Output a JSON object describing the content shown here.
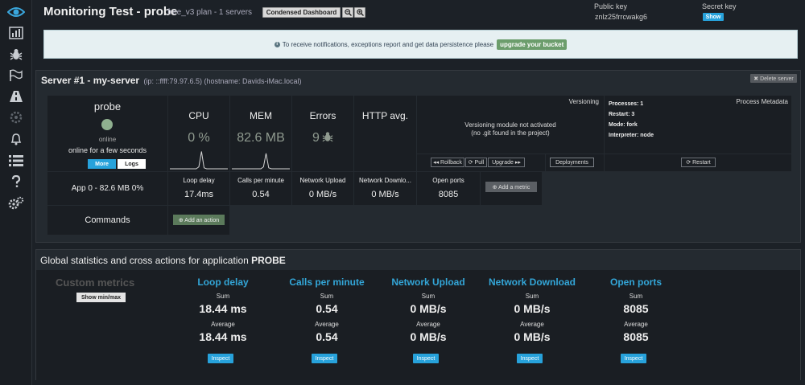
{
  "header": {
    "title": "Monitoring Test - probe",
    "plan_info": "free_v3 plan - 1 servers",
    "condensed_label": "Condensed Dashboard",
    "public_key_label": "Public key",
    "public_key_value": "znlz25frrcwakg6",
    "secret_key_label": "Secret key",
    "show_label": "Show"
  },
  "sidebar": {
    "icons": [
      "eye-icon",
      "bar-chart-icon",
      "bug-icon",
      "flag-icon",
      "road-icon",
      "cogs-icon",
      "bell-icon",
      "list-icon",
      "question-icon",
      "gears-icon"
    ]
  },
  "notice": {
    "text": "To receive notifications, exceptions report and get data persistence please",
    "button": "upgrade your bucket"
  },
  "server": {
    "title": "Server #1 - my-server",
    "subtitle": "(ip: ::ffff:79.97.6.5) (hostname: Davids-iMac.local)",
    "delete_label": "✖ Delete server",
    "process": {
      "name": "probe",
      "status": "online",
      "duration": "online for a few seconds",
      "more": "More",
      "logs": "Logs"
    },
    "metrics": {
      "cpu_label": "CPU",
      "cpu_value": "0 %",
      "mem_label": "MEM",
      "mem_value": "82.6 MB",
      "errors_label": "Errors",
      "errors_value": "9",
      "http_label": "HTTP avg."
    },
    "versioning": {
      "label": "Versioning",
      "message_line1": "Versioning module not activated",
      "message_line2": "(no .git found in the project)",
      "rollback": "◂◂ Rollback",
      "pull": "⟳ Pull",
      "upgrade": "Upgrade ▸▸",
      "deployments": "Deployments"
    },
    "process_meta": {
      "label": "Process Metadata",
      "processes": "Processes: 1",
      "restart_count": "Restart: 3",
      "mode": "Mode: fork",
      "interpreter": "Interpreter: node",
      "restart_button": "⟳ Restart"
    },
    "app_row": {
      "label": "App 0 - 82.6 MB 0%",
      "loop_label": "Loop delay",
      "loop_value": "17.4ms",
      "calls_label": "Calls per minute",
      "calls_value": "0.54",
      "up_label": "Network Upload",
      "up_value": "0 MB/s",
      "down_label": "Network Downlo...",
      "down_value": "0 MB/s",
      "ports_label": "Open ports",
      "ports_value": "8085",
      "add_metric": "⊕ Add a metric"
    },
    "commands": {
      "label": "Commands",
      "add_action": "⊕ Add an action"
    },
    "cpu_sparkline": [
      0,
      0,
      0,
      0,
      0,
      0,
      0,
      0,
      0,
      0,
      0,
      2,
      18,
      1,
      0,
      0,
      0,
      0,
      0,
      0,
      0,
      0,
      0
    ],
    "mem_sparkline": [
      0,
      0,
      0,
      0,
      0,
      0,
      0,
      0,
      0,
      0,
      0,
      0,
      2,
      16,
      1,
      0,
      0,
      0,
      0,
      0,
      0,
      0,
      0
    ]
  },
  "global": {
    "title_prefix": "Global statistics and cross actions for application",
    "app_name": "PROBE",
    "custom_title": "Custom metrics",
    "show_minmax": "Show min/max",
    "sum_label": "Sum",
    "avg_label": "Average",
    "inspect_label": "Inspect",
    "columns": [
      {
        "title": "Loop delay",
        "sum": "18.44 ms",
        "avg": "18.44 ms"
      },
      {
        "title": "Calls per minute",
        "sum": "0.54",
        "avg": "0.54"
      },
      {
        "title": "Network Upload",
        "sum": "0 MB/s",
        "avg": "0 MB/s"
      },
      {
        "title": "Network Download",
        "sum": "0 MB/s",
        "avg": "0 MB/s"
      },
      {
        "title": "Open ports",
        "sum": "8085",
        "avg": "8085"
      }
    ]
  },
  "colors": {
    "accent": "#27a2db",
    "online": "#8fb08f",
    "metric_title": "#33a6d8",
    "upgrade": "#6c9d6c"
  }
}
